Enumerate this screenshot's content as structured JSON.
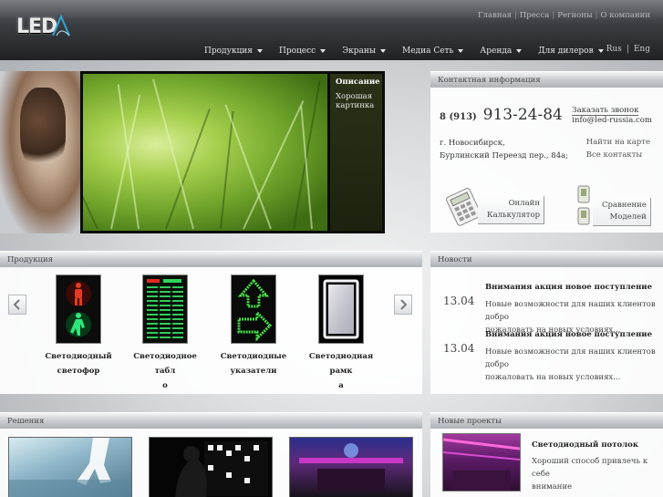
{
  "header": {
    "logo_text": "LED",
    "top_links": [
      "Главная",
      "Пресса",
      "Регионы",
      "О компании"
    ],
    "nav": [
      {
        "label": "Продукция"
      },
      {
        "label": "Процесс"
      },
      {
        "label": "Экраны"
      },
      {
        "label": "Медиа Сеть"
      },
      {
        "label": "Аренда"
      },
      {
        "label": "Для дилеров"
      }
    ],
    "lang": {
      "ru": "Rus",
      "sep": "|",
      "en": "Eng"
    }
  },
  "hero": {
    "caption_title": "Описание",
    "caption_text": "Хорошая картинка"
  },
  "contact": {
    "title": "Контактная информация",
    "phone_code": "8 (913)",
    "phone_number": "913-24-84",
    "address_line1": "г. Новосибирск,",
    "address_line2": "Бурлинский Переезд пер., 84а;",
    "order_call": "Заказать звонок",
    "email": "info@led-russia.com",
    "map_link": "Найти на карте",
    "all_contacts": "Все контакты",
    "calc_line1": "Онлайн",
    "calc_line2": "Калькулятор",
    "compare_line1": "Сравнение",
    "compare_line2": "Моделей"
  },
  "products": {
    "title": "Продукция",
    "items": [
      {
        "line1": "Светодиодный",
        "line2": "светофор"
      },
      {
        "line1": "Светодиодное табл",
        "line2": "о"
      },
      {
        "line1": "Светодиодные",
        "line2": "указатели"
      },
      {
        "line1": "Светодиодная рамк",
        "line2": "а"
      }
    ]
  },
  "news": {
    "title": "Новости",
    "items": [
      {
        "date": "13.04",
        "title": "Внимания акция новое поступление",
        "text1": "Новые возможности для наших клиентов добро",
        "text2": "пожаловать на новых условиях..."
      },
      {
        "date": "13.04",
        "title": "Внимания акция новое поступление",
        "text1": "Новые возможности для наших клиентов добро",
        "text2": "пожаловать на новых условиях..."
      }
    ]
  },
  "solutions": {
    "title": "Решения"
  },
  "projects": {
    "title": "Новые проекты",
    "item_title": "Светодиодный потолок",
    "item_text1": "Хороший способ привлечь к себе",
    "item_text2": "внимание"
  },
  "colors": {
    "accent_green": "#6ea32a",
    "header_dark": "#1f2124"
  }
}
